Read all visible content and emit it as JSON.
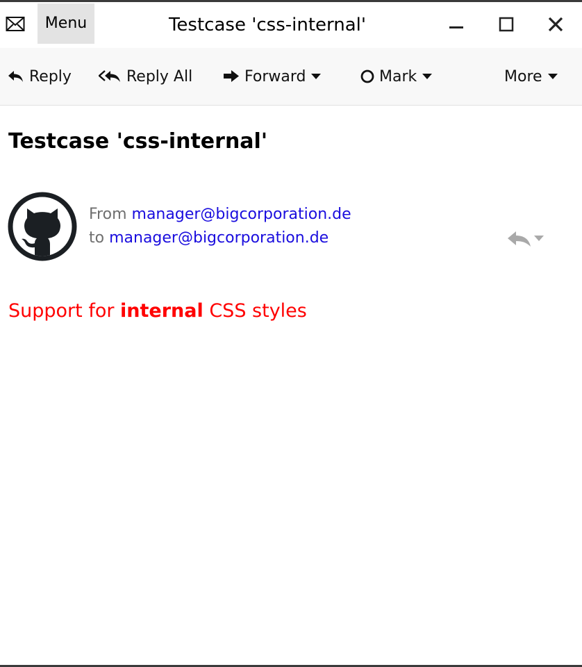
{
  "window": {
    "title": "Testcase 'css-internal'",
    "menu_label": "Menu"
  },
  "toolbar": {
    "reply_label": "Reply",
    "reply_all_label": "Reply All",
    "forward_label": "Forward",
    "mark_label": "Mark",
    "more_label": "More"
  },
  "message": {
    "subject": "Testcase 'css-internal'",
    "from_label": "From",
    "from_address": "manager@bigcorporation.de",
    "to_label": "to",
    "to_address": "manager@bigcorporation.de",
    "body_prefix": "Support for ",
    "body_bold": "internal",
    "body_suffix": " CSS styles"
  },
  "colors": {
    "link": "#1a0dde",
    "body_text": "#ff0000",
    "meta_text": "#6f6f6f"
  },
  "icons": [
    "envelope-icon",
    "minimize-icon",
    "maximize-icon",
    "close-icon",
    "reply-icon",
    "reply-all-icon",
    "forward-icon",
    "mark-circle-icon",
    "chevron-down-icon",
    "github-avatar"
  ]
}
